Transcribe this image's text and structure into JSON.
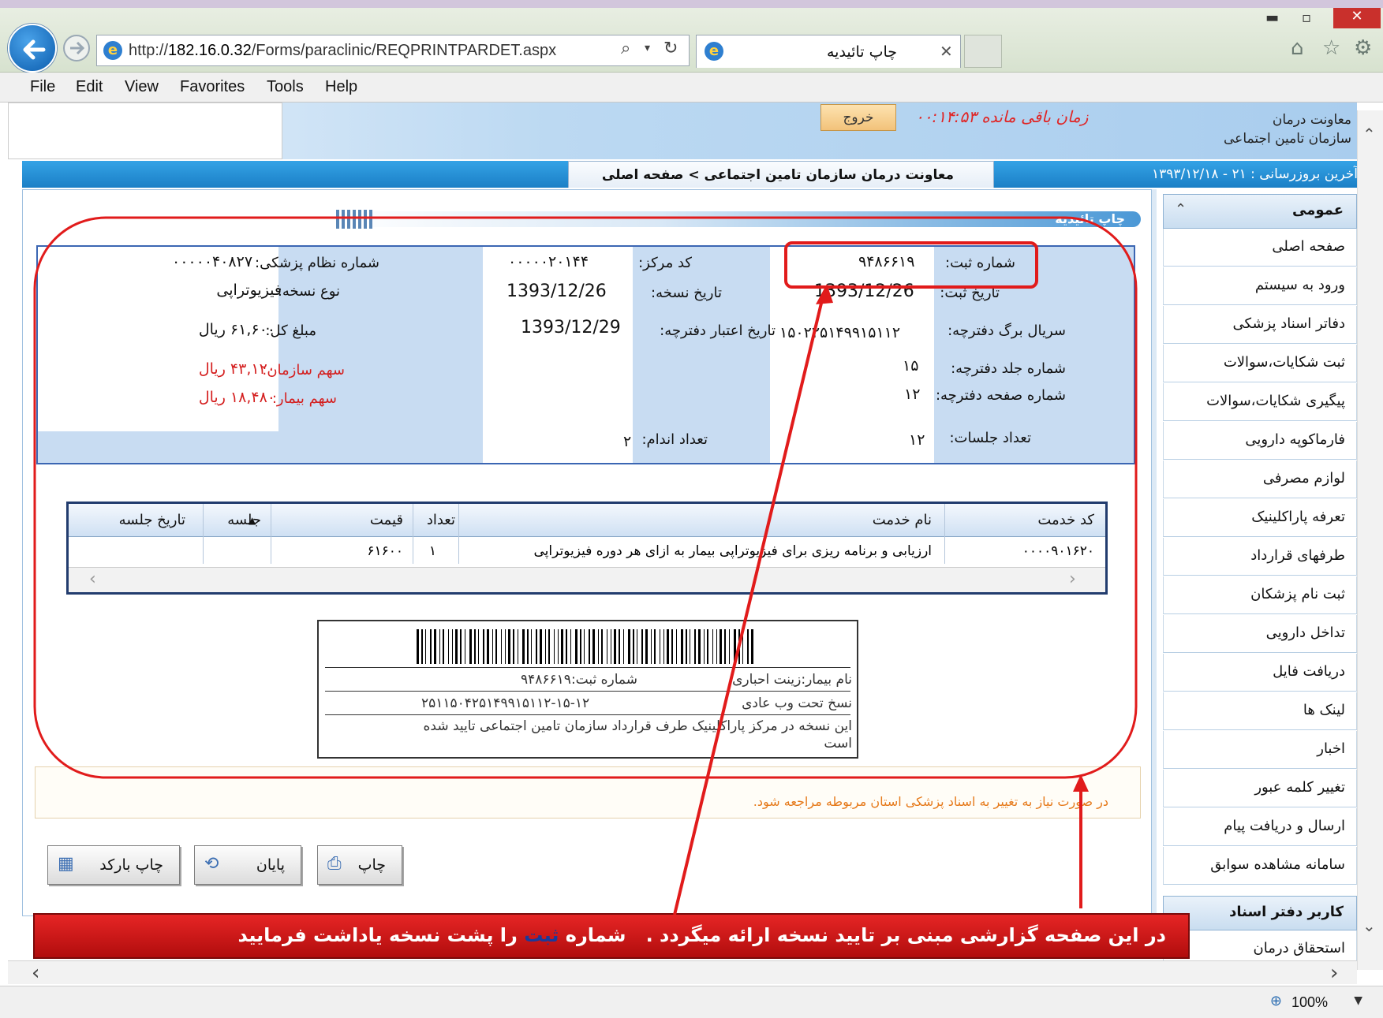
{
  "browser": {
    "url_prefix": "http://",
    "url_host": "182.16.0.32",
    "url_path": "/Forms/paraclinic/REQPRINTPARDET.aspx",
    "tab_title": "چاپ تائیدیه",
    "menu": [
      "File",
      "Edit",
      "View",
      "Favorites",
      "Tools",
      "Help"
    ],
    "zoom": "100%"
  },
  "header": {
    "exit_label": "خروج",
    "timer": "زمان باقی مانده ۰۰:۱۴:۵۳",
    "org_line1": "معاونت درمان",
    "org_line2": "سازمان تامین اجتماعی",
    "breadcrumb": "معاونت درمان سازمان تامین اجتماعی > صفحه اصلی",
    "last_update": "آخرین بروزرسانی : ۲۱ - ۱۳۹۳/۱۲/۱۸"
  },
  "sidebar": {
    "section_title": "عمومی",
    "items": [
      "صفحه اصلی",
      "ورود به سیستم",
      "دفاتر اسناد پزشکی",
      "ثبت شکایات،سوالات",
      "پیگیری شکایات،سوالات",
      "فارماکوپه دارویی",
      "لوازم مصرفی",
      "تعرفه پاراکلینیک",
      "طرفهای قرارداد",
      "ثبت نام پزشکان",
      "تداخل دارویی",
      "دریافت فایل",
      "لینک ها",
      "اخبار",
      "تغییر کلمه عبور",
      "ارسال و دریافت پیام",
      "سامانه مشاهده سوابق"
    ],
    "section2_title": "کاربر دفتر اسناد",
    "section2_item": "استحقاق درمان"
  },
  "print_bar_label": "چاپ تائیدیه",
  "info": {
    "reg_no_label": "شماره ثبت:",
    "reg_no": "۹۴۸۶۶۱۹",
    "reg_date_label": "تاریخ ثبت:",
    "reg_date": "1393/12/26",
    "serial_label": "سریال برگ دفترچه:",
    "serial": "۱۵۰۲۲۵۱۴۹۹۱۵۱۱۲",
    "booklet_vol_label": "شماره جلد دفترچه:",
    "booklet_vol": "۱۵",
    "booklet_page_label": "شماره صفحه دفترچه:",
    "booklet_page": "۱۲",
    "sessions_label": "تعداد جلسات:",
    "sessions": "۱۲",
    "center_code_label": "کد مرکز:",
    "center_code": "۰۰۰۰۰۲۰۱۴۴",
    "rx_date_label": "تاریخ نسخه:",
    "rx_date": "1393/12/26",
    "validity_label": "تاریخ اعتبار دفترچه:",
    "validity": "1393/12/29",
    "organs_label": "تعداد اندام:",
    "organs": "۲",
    "doctor_label": "شماره نظام پزشکی:",
    "doctor_no": "۰۰۰۰۰۴۰۸۲۷",
    "rx_type_label": "نوع نسخه:",
    "rx_type": "فیزیوتراپی",
    "total_label": "مبلغ کل:",
    "total": "۶۱,۶۰۰ ریال",
    "org_share_label": "سهم سازمان:",
    "org_share": "۴۳,۱۲۰ ریال",
    "patient_share_label": "سهم بیمار:",
    "patient_share": "۱۸,۴۸۰ ریال"
  },
  "services": {
    "headers": [
      "کد خدمت",
      "نام خدمت",
      "تعداد",
      "قیمت",
      "جلسه",
      "تاریخ جلسه"
    ],
    "rows": [
      {
        "code": "۰۰۰۰۹۰۱۶۲۰",
        "name": "ارزیابی و برنامه ریزی برای فیزیوتراپی بیمار به ازای هر دوره فیزیوتراپی",
        "count": "۱",
        "price": "۶۱۶۰۰",
        "session": "",
        "session_date": ""
      }
    ]
  },
  "barcode": {
    "patient_label": "نام بیمار:زینت احباری",
    "reg_label": "شماره ثبت:۹۴۸۶۶۱۹",
    "rx_label": "نسخ تحت وب عادی",
    "code": "۲۵۱۱۵۰۴۲۵۱۴۹۹۱۵۱۱۲-۱۵-۱۲",
    "desc": "این نسخه در مرکز پاراکلینیک طرف قرارداد سازمان تامین اجتماعی تایید شده است"
  },
  "note": "در صورت نیاز به تغییر به اسناد پزشکی استان مربوطه مراجعه شود.",
  "buttons": {
    "print": "چاپ",
    "finish": "پایان",
    "barcode_print": "چاپ بارکد"
  },
  "banner": {
    "part1": "در این صفحه گزارشی مبنی بر تایید نسخه ارائه میگردد .",
    "part2": "شماره",
    "part3": "ثبت",
    "part4": "را پشت نسخه یاداشت فرمایید"
  },
  "colors": {
    "annotation_red": "#e11b1b",
    "panel_blue": "#c8dcf2",
    "header_blue": "#1b7fc6"
  }
}
